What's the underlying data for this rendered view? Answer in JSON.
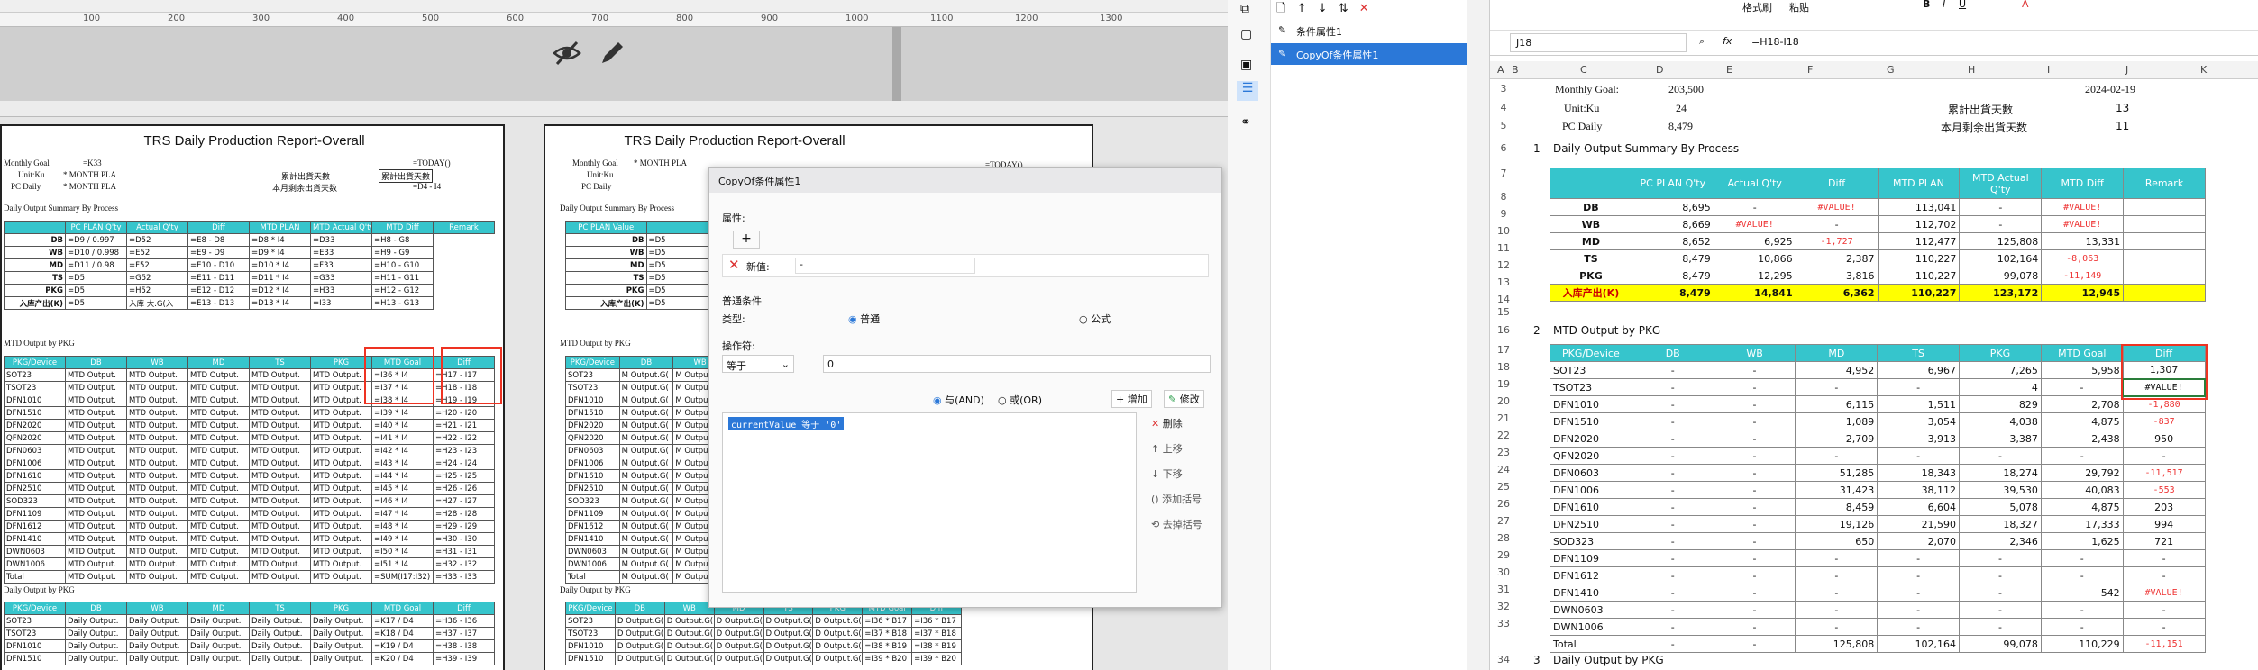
{
  "toolbar": {
    "icons": [
      "file-icon",
      "up-icon",
      "down-icon",
      "sort-icon",
      "delete-icon"
    ]
  },
  "ruler": {
    "ticks": [
      "100",
      "200",
      "300",
      "400",
      "500",
      "600",
      "700",
      "800",
      "900",
      "1000",
      "1100",
      "1200",
      "1300"
    ]
  },
  "report": {
    "title": "TRS Daily Production Report-Overall",
    "monthly_goal_label": "Monthly Goal",
    "monthly_goal_val": "=K33",
    "unit_label": "Unit:Ku",
    "unit_val": "* MONTH PLA",
    "pc_label": "PC Daily",
    "pc_val": "* MONTH PLA",
    "today": "=TODAY()",
    "cum_days": "累計出貨天數",
    "cum_days_box": "累計出貨天數",
    "remain_days": "本月剩余出貨天数",
    "remain_val": "=D4 - I4",
    "sec1": "Daily Output Summary By Process",
    "sec2": "MTD Output by PKG",
    "sec3": "Daily Output by PKG",
    "sum_headers": [
      "PC PLAN Q'ty",
      "Actual Q'ty",
      "Diff",
      "MTD PLAN",
      "MTD  Actual Q'ty",
      "MTD Diff",
      "Remark"
    ],
    "sum_rows": [
      [
        "DB",
        "=D9 / 0.997",
        "=D52",
        "=E8 - D8",
        "=D8 * I4",
        "=D33",
        "=H8 - G8"
      ],
      [
        "WB",
        "=D10 / 0.998",
        "=E52",
        "=E9 - D9",
        "=D9 * I4",
        "=E33",
        "=H9 - G9"
      ],
      [
        "MD",
        "=D11 / 0.98",
        "=F52",
        "=E10 - D10",
        "=D10 * I4",
        "=F33",
        "=H10 - G10"
      ],
      [
        "TS",
        "=D5",
        "=G52",
        "=E11 - D11",
        "=D11 * I4",
        "=G33",
        "=H11 - G11"
      ],
      [
        "PKG",
        "=D5",
        "=H52",
        "=E12 - D12",
        "=D12 * I4",
        "=H33",
        "=H12 - G12"
      ],
      [
        "入库产出(K)",
        "=D5",
        "入库 大.G(入",
        "=E13 - D13",
        "=D13 * I4",
        "=I33",
        "=H13 - G13"
      ]
    ],
    "pkg_headers": [
      "PKG/Device",
      "DB",
      "WB",
      "MD",
      "TS",
      "PKG",
      "MTD Goal",
      "Diff"
    ],
    "pkg_rows": [
      [
        "SOT23",
        "=I36 * I4",
        "=H17 - I17"
      ],
      [
        "TSOT23",
        "=I37 * I4",
        "=H18 - I18"
      ],
      [
        "DFN1010",
        "=I38 * I4",
        "=H19 - I19"
      ],
      [
        "DFN1510",
        "=I39 * I4",
        "=H20 - I20"
      ],
      [
        "DFN2020",
        "=I40 * I4",
        "=H21 - I21"
      ],
      [
        "QFN2020",
        "=I41 * I4",
        "=H22 - I22"
      ],
      [
        "DFN0603",
        "=I42 * I4",
        "=H23 - I23"
      ],
      [
        "DFN1006",
        "=I43 * I4",
        "=H24 - I24"
      ],
      [
        "DFN1610",
        "=I44 * I4",
        "=H25 - I25"
      ],
      [
        "DFN2510",
        "=I45 * I4",
        "=H26 - I26"
      ],
      [
        "SOD323",
        "=I46 * I4",
        "=H27 - I27"
      ],
      [
        "DFN1109",
        "=I47 * I4",
        "=H28 - I28"
      ],
      [
        "DFN1612",
        "=I48 * I4",
        "=H29 - I29"
      ],
      [
        "DFN1410",
        "=I49 * I4",
        "=H30 - I30"
      ],
      [
        "DWN0603",
        "=I50 * I4",
        "=H31 - I31"
      ],
      [
        "DWN1006",
        "=I51 * I4",
        "=H32 - I32"
      ],
      [
        "Total",
        "=SUM(I17:I32)",
        "=H33 - I33"
      ]
    ],
    "mtd_cell": "MTD Output.",
    "daily_rows": [
      [
        "SOT23",
        "=K17 / D4",
        "=H36 - I36"
      ],
      [
        "TSOT23",
        "=K18 / D4",
        "=H37 - I37"
      ],
      [
        "DFN1010",
        "=K19 / D4",
        "=H38 - I38"
      ],
      [
        "DFN1510",
        "=K20 / D4",
        "=H39 - I39"
      ]
    ],
    "daily_cell": "Daily Output."
  },
  "report2": {
    "title": "TRS Daily Production Report-Overall",
    "monthly_goal_label": "Monthly Goal",
    "monthly_goal_val": "* MONTH PLA",
    "unit_label": "Unit:Ku",
    "pc_label": "PC Daily",
    "today": "=TODAY()",
    "sec1": "Daily Output Summary By Process",
    "sec2": "MTD Output by PKG",
    "sec3": "Daily Output by PKG",
    "plan_header": "PC PLAN Value",
    "cell": "=D5",
    "mcell": "M Output.G(",
    "dcell": "D Output.G(",
    "daily_rows": [
      [
        "SOT23",
        "=I36 * B17",
        "=I36 * B17"
      ],
      [
        "TSOT23",
        "=I37 * B18",
        "=I37 * B18"
      ],
      [
        "DFN1010",
        "=I38 * B19",
        "=I38 * B19"
      ],
      [
        "DFN1510",
        "=I39 * B20",
        "=I39 * B20"
      ]
    ]
  },
  "dialog": {
    "title": "CopyOf条件属性1",
    "attr_label": "属性:",
    "add_label": "+",
    "new_label": "新值:",
    "new_val": "-",
    "cond_label": "普通条件",
    "type_label": "类型:",
    "type_opt1": "普通",
    "type_opt2": "公式",
    "op_label": "操作符:",
    "op_val": "等于",
    "op_input": "0",
    "and_label": "与(AND)",
    "or_label": "或(OR)",
    "add_btn": "增加",
    "modify_btn": "修改",
    "expr": "currentValue 等于 '0'",
    "del_btn": "删除",
    "up_btn": "上移",
    "down_btn": "下移",
    "addbr_btn": "添加括号",
    "rmbr_btn": "去掉括号"
  },
  "tree": {
    "items": [
      "条件属性1",
      "CopyOf条件属性1"
    ]
  },
  "excel": {
    "ribbon": [
      "格式刷",
      "粘贴"
    ],
    "namebox": "J18",
    "fx": "fx",
    "formula": "=H18-I18",
    "cols": [
      "A",
      "B",
      "C",
      "D",
      "E",
      "F",
      "G",
      "H",
      "I",
      "J",
      "K"
    ],
    "r3": {
      "label": "Monthly Goal:",
      "val": "203,500",
      "date": "2024-02-19"
    },
    "r4": {
      "label": "Unit:Ku",
      "val": "24",
      "label2": "累計出貨天數",
      "val2": "13"
    },
    "r5": {
      "label": "PC Daily",
      "val": "8,479",
      "label2": "本月剩余出貨天数",
      "val2": "11"
    },
    "sec1": "Daily Output Summary By Process",
    "sec2": "MTD Output by PKG",
    "sec3": "Daily Output by PKG",
    "n1": "1",
    "n2": "2",
    "n3": "3",
    "sum_headers": [
      "PC PLAN Q'ty",
      "Actual Q'ty",
      "Diff",
      "MTD PLAN",
      "MTD  Actual Q'ty",
      "MTD Diff",
      "Remark"
    ],
    "sum_rows": [
      [
        "DB",
        "8,695",
        "-",
        "#VALUE!",
        "113,041",
        "-",
        "#VALUE!",
        ""
      ],
      [
        "WB",
        "8,669",
        "#VALUE!",
        "-",
        "112,702",
        "-",
        "#VALUE!",
        ""
      ],
      [
        "MD",
        "8,652",
        "6,925",
        "-1,727",
        "112,477",
        "125,808",
        "13,331",
        ""
      ],
      [
        "TS",
        "8,479",
        "10,866",
        "2,387",
        "110,227",
        "102,164",
        "-8,063",
        ""
      ],
      [
        "PKG",
        "8,479",
        "12,295",
        "3,816",
        "110,227",
        "99,078",
        "-11,149",
        ""
      ],
      [
        "入库产出(K)",
        "8,479",
        "14,841",
        "6,362",
        "110,227",
        "123,172",
        "12,945",
        ""
      ]
    ],
    "pkg_headers": [
      "PKG/Device",
      "DB",
      "WB",
      "MD",
      "TS",
      "PKG",
      "MTD Goal",
      "Diff"
    ],
    "pkg_rows": [
      [
        "SOT23",
        "-",
        "-",
        "4,952",
        "6,967",
        "7,265",
        "5,958",
        "1,307"
      ],
      [
        "TSOT23",
        "-",
        "-",
        "-",
        "-",
        "4",
        "-",
        "#VALUE!"
      ],
      [
        "DFN1010",
        "-",
        "-",
        "6,115",
        "1,511",
        "829",
        "2,708",
        "-1,880"
      ],
      [
        "DFN1510",
        "-",
        "-",
        "1,089",
        "3,054",
        "4,038",
        "4,875",
        "-837"
      ],
      [
        "DFN2020",
        "-",
        "-",
        "2,709",
        "3,913",
        "3,387",
        "2,438",
        "950"
      ],
      [
        "QFN2020",
        "-",
        "-",
        "-",
        "-",
        "-",
        "-",
        "-"
      ],
      [
        "DFN0603",
        "-",
        "-",
        "51,285",
        "18,343",
        "18,274",
        "29,792",
        "-11,517"
      ],
      [
        "DFN1006",
        "-",
        "-",
        "31,423",
        "38,112",
        "39,530",
        "40,083",
        "-553"
      ],
      [
        "DFN1610",
        "-",
        "-",
        "8,459",
        "6,604",
        "5,078",
        "4,875",
        "203"
      ],
      [
        "DFN2510",
        "-",
        "-",
        "19,126",
        "21,590",
        "18,327",
        "17,333",
        "994"
      ],
      [
        "SOD323",
        "-",
        "-",
        "650",
        "2,070",
        "2,346",
        "1,625",
        "721"
      ],
      [
        "DFN1109",
        "-",
        "-",
        "-",
        "-",
        "-",
        "-",
        "-"
      ],
      [
        "DFN1612",
        "-",
        "-",
        "-",
        "-",
        "-",
        "-",
        "-"
      ],
      [
        "DFN1410",
        "-",
        "-",
        "-",
        "-",
        "-",
        "542",
        "#VALUE!"
      ],
      [
        "DWN0603",
        "-",
        "-",
        "-",
        "-",
        "-",
        "-",
        "-"
      ],
      [
        "DWN1006",
        "-",
        "-",
        "-",
        "-",
        "-",
        "-",
        "-"
      ],
      [
        "Total",
        "-",
        "-",
        "125,808",
        "102,164",
        "99,078",
        "110,229",
        "-11,151"
      ]
    ],
    "row_nums": [
      "3",
      "4",
      "5",
      "6",
      "7",
      "8",
      "9",
      "10",
      "11",
      "12",
      "13",
      "14",
      "15",
      "16",
      "17",
      "18",
      "19",
      "20",
      "21",
      "22",
      "23",
      "24",
      "25",
      "26",
      "27",
      "28",
      "29",
      "30",
      "31",
      "32",
      "33",
      "34"
    ]
  }
}
